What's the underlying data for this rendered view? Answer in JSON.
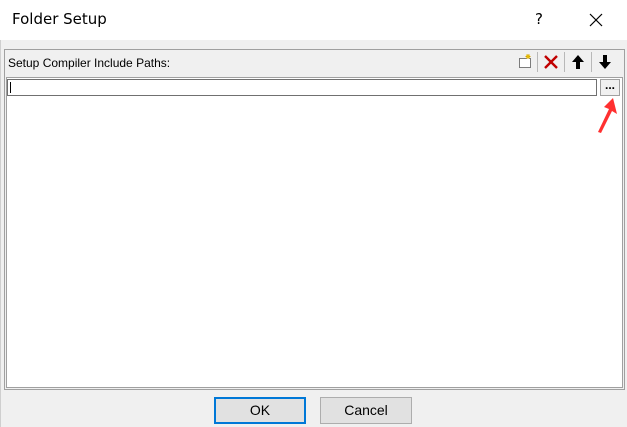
{
  "window": {
    "title": "Folder Setup",
    "help_label": "?",
    "close_icon": "close-icon"
  },
  "panel": {
    "label": "Setup Compiler Include Paths:",
    "toolbar": [
      {
        "name": "new-folder-button",
        "icon": "new-folder-icon"
      },
      {
        "name": "delete-button",
        "icon": "delete-x-icon",
        "color": "#c00000"
      },
      {
        "name": "move-up-button",
        "icon": "arrow-up-icon"
      },
      {
        "name": "move-down-button",
        "icon": "arrow-down-icon"
      }
    ],
    "path_input": {
      "value": ""
    },
    "browse_label": "...",
    "annotation": {
      "icon": "red-pointer-arrow",
      "color": "#ff3030"
    }
  },
  "buttons": {
    "ok": "OK",
    "cancel": "Cancel"
  }
}
